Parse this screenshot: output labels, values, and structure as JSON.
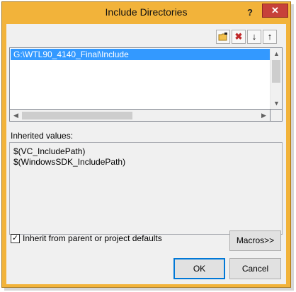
{
  "window": {
    "title": "Include Directories",
    "help_glyph": "?",
    "close_glyph": "✕"
  },
  "toolbar": {
    "new_line_glyph": "▰",
    "delete_glyph": "✖",
    "move_down_glyph": "↓",
    "move_up_glyph": "↑"
  },
  "directories": {
    "items": [
      "G:\\WTL90_4140_Final\\Include"
    ]
  },
  "inherited": {
    "label": "Inherited values:",
    "items": [
      "$(VC_IncludePath)",
      "$(WindowsSDK_IncludePath)"
    ]
  },
  "inherit": {
    "checked_glyph": "✓",
    "label": "Inherit from parent or project defaults"
  },
  "buttons": {
    "macros": "Macros>>",
    "ok": "OK",
    "cancel": "Cancel"
  },
  "scroll": {
    "up": "▲",
    "down": "▼",
    "left": "◀",
    "right": "▶"
  }
}
